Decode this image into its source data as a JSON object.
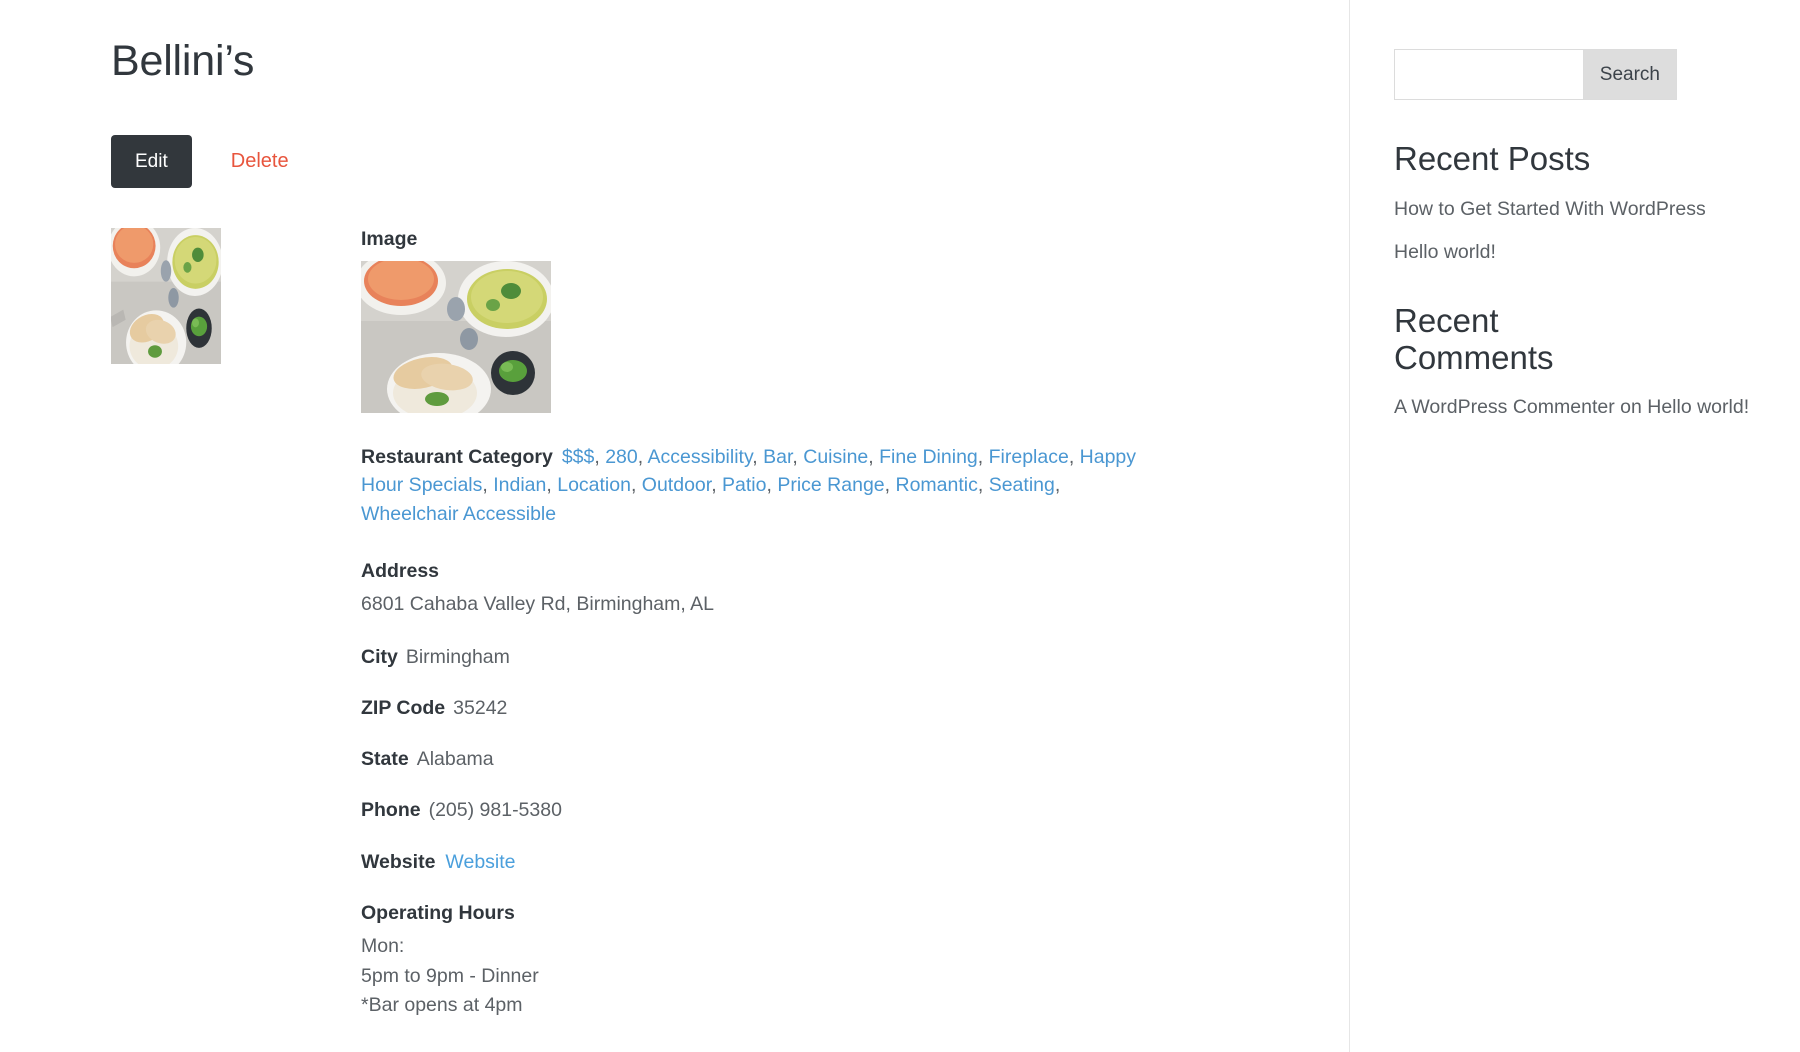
{
  "page": {
    "title": "Bellini’s"
  },
  "actions": {
    "edit_label": "Edit",
    "delete_label": "Delete"
  },
  "fields": {
    "image_label": "Image",
    "category_label": "Restaurant Category",
    "categories": [
      "$$$",
      "280",
      "Accessibility",
      "Bar",
      "Cuisine",
      "Fine Dining",
      "Fireplace",
      "Happy Hour Specials",
      "Indian",
      "Location",
      "Outdoor",
      "Patio",
      "Price Range",
      "Romantic",
      "Seating",
      "Wheelchair Accessible"
    ],
    "address_label": "Address",
    "address_value": "6801 Cahaba Valley Rd, Birmingham, AL",
    "city_label": "City",
    "city_value": "Birmingham",
    "zip_label": "ZIP Code",
    "zip_value": "35242",
    "state_label": "State",
    "state_value": "Alabama",
    "phone_label": "Phone",
    "phone_value": "(205) 981-5380",
    "website_label": "Website",
    "website_link_text": "Website",
    "hours_label": "Operating Hours",
    "hours_lines": [
      "Mon:",
      "5pm to 9pm - Dinner",
      "*Bar opens at 4pm"
    ]
  },
  "sidebar": {
    "search": {
      "value": "",
      "placeholder": "",
      "submit_label": "Search"
    },
    "recent_posts": {
      "title": "Recent Posts",
      "items": [
        "How to Get Started With WordPress",
        "Hello world!"
      ]
    },
    "recent_comments": {
      "title": "Recent Comments",
      "items": [
        {
          "author": "A WordPress Commenter",
          "connector": "on",
          "post": "Hello world!"
        }
      ]
    }
  },
  "colors": {
    "edit_button_bg": "#32373c",
    "delete_text": "#e8553d",
    "link_blue": "#4a97d2",
    "text_dark": "#31373d",
    "text_muted": "#5c6166"
  }
}
